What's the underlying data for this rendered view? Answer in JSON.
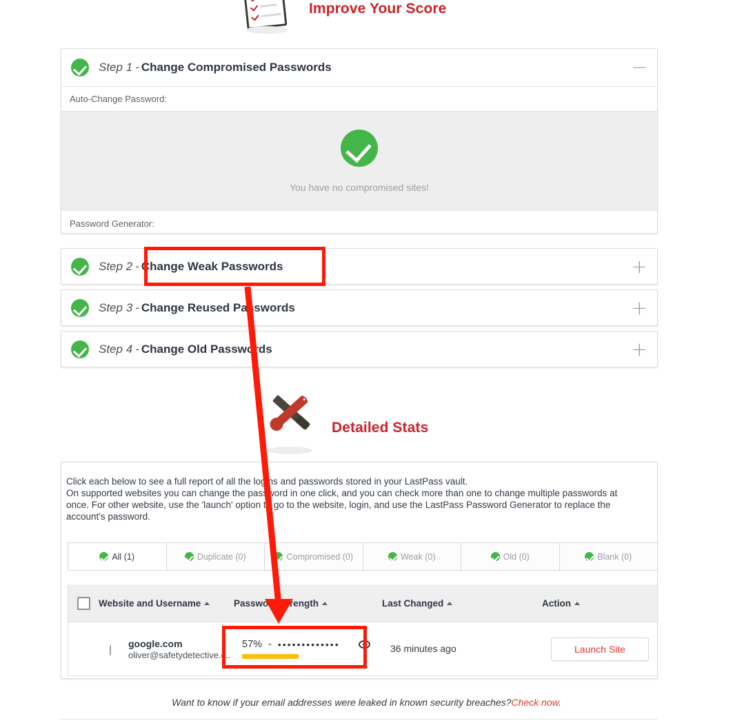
{
  "improve": {
    "title": "Improve Your Score",
    "icon": "clipboard-checklist-icon",
    "steps": [
      {
        "num": "Step 1",
        "dash": "-",
        "name": "Change Compromised Passwords",
        "toggle": "−",
        "toggle_name": "collapse-icon",
        "expanded": true,
        "auto_change_label": "Auto-Change Password:",
        "empty_message": "You have no compromised sites!",
        "generator_label": "Password Generator:"
      },
      {
        "num": "Step 2",
        "dash": "-",
        "name": "Change Weak Passwords",
        "toggle": "+",
        "toggle_name": "expand-icon",
        "expanded": false
      },
      {
        "num": "Step 3",
        "dash": "-",
        "name": "Change Reused Passwords",
        "toggle": "+",
        "toggle_name": "expand-icon",
        "expanded": false
      },
      {
        "num": "Step 4",
        "dash": "-",
        "name": "Change Old Passwords",
        "toggle": "+",
        "toggle_name": "expand-icon",
        "expanded": false
      }
    ]
  },
  "detailed": {
    "title": "Detailed Stats",
    "icon": "wrench-screwdriver-icon",
    "description_lines": [
      "Click each below to see a full report of all the logins and passwords stored in your LastPass vault.",
      "On supported websites you can change the password in one click, and you can check more than one to change multiple passwords at",
      "once. For other website, use the 'launch' option to go to the website, login, and use the LastPass Password Generator to replace the",
      "account's password."
    ],
    "tabs": [
      {
        "label": "All (1)",
        "active": true
      },
      {
        "label": "Duplicate (0)",
        "active": false
      },
      {
        "label": "Compromised (0)",
        "active": false
      },
      {
        "label": "Weak (0)",
        "active": false
      },
      {
        "label": "Old (0)",
        "active": false
      },
      {
        "label": "Blank (0)",
        "active": false
      }
    ],
    "columns": [
      {
        "label": "Website and Username",
        "sort": "asc"
      },
      {
        "label": "Password Strength",
        "sort": "asc"
      },
      {
        "label": "Last Changed",
        "sort": "asc"
      },
      {
        "label": "Action",
        "sort": "asc"
      }
    ],
    "rows": [
      {
        "site": "google.com",
        "username": "oliver@safetydetective.c..",
        "strength_percent": "57%",
        "strength_separator": "-",
        "strength_value": 57,
        "masked_password": "•••••••••••••",
        "last_changed": "36 minutes ago",
        "action_label": "Launch Site"
      }
    ]
  },
  "footer": {
    "text": "Want to know if your email addresses were leaked in known security breaches?",
    "link": "Check now",
    "period": "."
  },
  "colors": {
    "accent_red": "#cc2229",
    "link_red": "#e8342b",
    "green": "#44b549",
    "strength_amber": "#f7c010",
    "annotation_red": "#ff1a07"
  }
}
